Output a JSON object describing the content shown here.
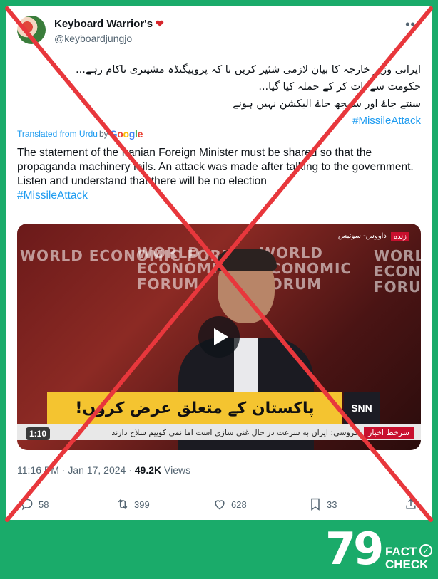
{
  "tweet": {
    "display_name": "Keyboard Warrior's",
    "badge": "heart-icon",
    "handle": "@keyboardjungjo",
    "urdu_lines": [
      "ایرانی وزیر خارجہ کا بیان لازمی شئیر کریں تا کہ پروپیگنڈہ مشینری ناکام رہے...",
      "حکومت سے بات کر کے حملہ کیا گیا...",
      "سنتے جاۓ اور سمجھ جاۓ الیکشن نہیں ہونے",
      "#MissileAttack"
    ],
    "translated_from": "Translated from Urdu",
    "by": "by",
    "google": [
      "G",
      "o",
      "o",
      "g",
      "l",
      "e"
    ],
    "translation_lines": [
      "The statement of the Iranian Foreign Minister must be shared so that the propaganda machinery fails. An attack was made after talking to the government.",
      "Listen and understand that there will be no election",
      "#MissileAttack"
    ],
    "time": "11:16 PM",
    "date": "Jan 17, 2024",
    "views_count": "49.2K",
    "views_label": "Views"
  },
  "video": {
    "wef_text": "WORLD ECONOMIC FORUM",
    "channel_location": "داووس- سوئیس",
    "live_label": "زنده",
    "banner_text": "پاکستان کے متعلق عرض کروں!",
    "network_logo": "SNN",
    "ticker_label": "سرخط اخبار",
    "ticker_text": "گروسی: ایران به سرعت در حال غنی سازی است اما نمی کوییم سلاح دارند",
    "duration": "1:10"
  },
  "actions": {
    "replies": "58",
    "reposts": "399",
    "likes": "628",
    "bookmarks": "33"
  },
  "logo": {
    "number": "79",
    "fact": "FACT",
    "check": "CHECK"
  },
  "colors": {
    "frame_green": "#1aab6a",
    "cross_red": "#e8373c",
    "link_blue": "#1d9bf0"
  }
}
